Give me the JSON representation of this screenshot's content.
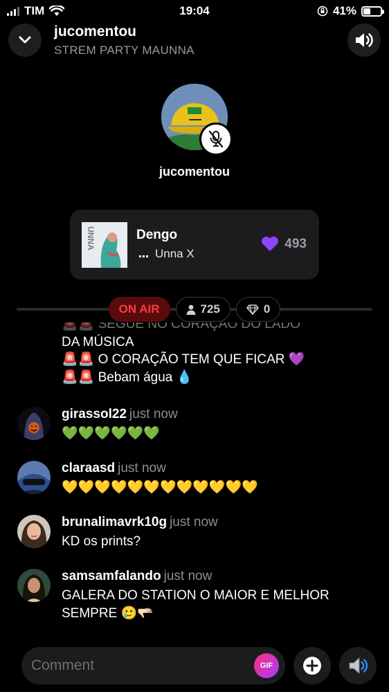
{
  "status_bar": {
    "carrier": "TIM",
    "time": "19:04",
    "battery": "41%",
    "battery_level": 0.41
  },
  "header": {
    "title": "jucomentou",
    "subtitle": "STREM PARTY MAUNNA"
  },
  "host": {
    "name": "jucomentou"
  },
  "music": {
    "title": "Dengo",
    "artist": "Unna X",
    "likes": "493",
    "album_text": "UNNA"
  },
  "stats": {
    "on_air": "ON AIR",
    "listeners": "725",
    "gems": "0"
  },
  "chat": {
    "top_message": {
      "line0": "🚨🚨 SEGUE NO CORAÇÃO DO LADO",
      "line1": "DA MÚSICA",
      "line2": "🚨🚨 O CORAÇÃO TEM QUE FICAR 💜",
      "line3": "🚨🚨 Bebam água 💧"
    },
    "messages": [
      {
        "user": "girassol22",
        "time": "just now",
        "text": "💚💚💚💚💚💚"
      },
      {
        "user": "claraasd",
        "time": "just now",
        "text": "💛💛💛💛💛💛💛💛💛💛💛💛"
      },
      {
        "user": "brunalimavrk10g",
        "time": "just now",
        "text": "KD os prints?"
      },
      {
        "user": "samsamfalando",
        "time": "just now",
        "text": "GALERA DO STATION O MAIOR E MELHOR SEMPRE 🥲🫳🏻"
      }
    ]
  },
  "composer": {
    "placeholder": "Comment",
    "gif_label": "GIF"
  },
  "colors": {
    "on_air_bg": "#5a0b0e",
    "on_air_text": "#ff3b3f",
    "heart": "#8e44ff"
  }
}
